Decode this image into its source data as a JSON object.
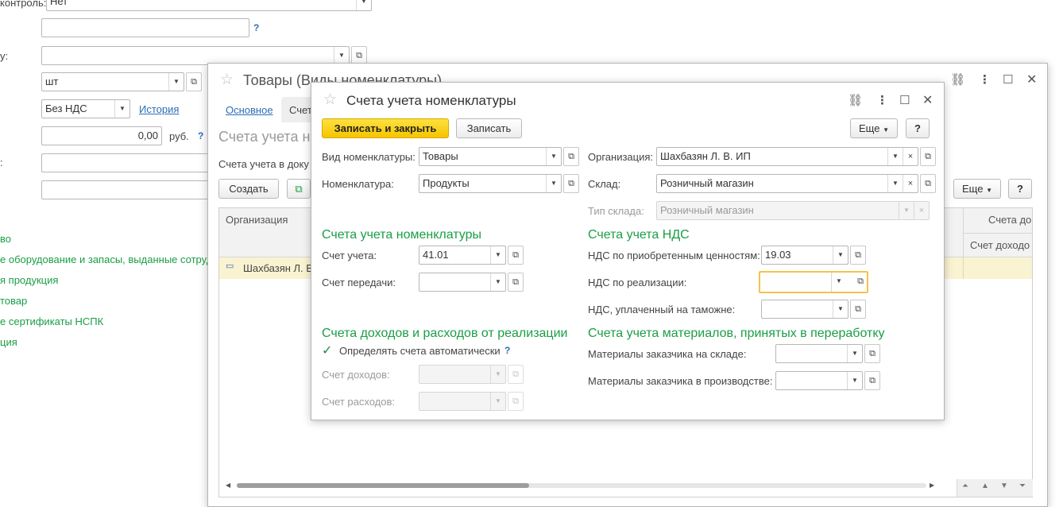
{
  "bg_form": {
    "control_label": "контроль:",
    "control_value": "Нет",
    "label_y": "у:",
    "unit_value": "шт",
    "vat_value": "Без НДС",
    "history_link": "История",
    "amount_value": "0,00",
    "currency": "руб.",
    "help": "?",
    "colon_label": ":",
    "green_links": [
      "во",
      "е оборудование и запасы, выданные сотруд",
      "я продукция",
      "товар",
      "е сертификаты НСПК",
      "ция"
    ]
  },
  "middle_window": {
    "title": "Товары (Виды номенклатуры)",
    "tabs": [
      "Основное",
      "Счет"
    ],
    "heading": "Счета учета н",
    "subtext": "Счета учета в доку",
    "create_button": "Создать",
    "more_button": "Еще",
    "help_button": "?",
    "table": {
      "col_org": "Организация",
      "col_right": "Счета до",
      "col_right_sub": "Счет доходо",
      "row_org": "Шахбазян Л. В"
    }
  },
  "dialog": {
    "title": "Счета учета номенклатуры",
    "save_close_button": "Записать и закрыть",
    "save_button": "Записать",
    "more_button": "Еще",
    "help_button": "?",
    "fields": {
      "kind_label": "Вид номенклатуры:",
      "kind_value": "Товары",
      "item_label": "Номенклатура:",
      "item_value": "Продукты",
      "org_label": "Организация:",
      "org_value": "Шахбазян Л. В. ИП",
      "warehouse_label": "Склад:",
      "warehouse_value": "Розничный магазин",
      "wh_type_label": "Тип склада:",
      "wh_type_value": "Розничный магазин"
    },
    "section_accounts": {
      "title": "Счета учета номенклатуры",
      "account_label": "Счет учета:",
      "account_value": "41.01",
      "transfer_label": "Счет передачи:",
      "transfer_value": ""
    },
    "section_vat": {
      "title": "Счета учета НДС",
      "purchased_label": "НДС по приобретенным ценностям:",
      "purchased_value": "19.03",
      "sales_label": "НДС по реализации:",
      "sales_value": "",
      "customs_label": "НДС, уплаченный на таможне:",
      "customs_value": ""
    },
    "section_income": {
      "title": "Счета доходов и расходов от реализации",
      "auto_checkbox_label": "Определять счета автоматически",
      "auto_checked": true,
      "help": "?",
      "income_label": "Счет доходов:",
      "expense_label": "Счет расходов:"
    },
    "section_materials": {
      "title": "Счета учета материалов, принятых в переработку",
      "warehouse_label": "Материалы заказчика на складе:",
      "production_label": "Материалы заказчика в производстве:"
    }
  },
  "icons": {
    "star": "☆",
    "link": "🔗",
    "menu": "⋮",
    "maximize": "☐",
    "close": "✕",
    "dropdown": "▼",
    "clear": "×",
    "open": "⧉",
    "check": "✓"
  }
}
